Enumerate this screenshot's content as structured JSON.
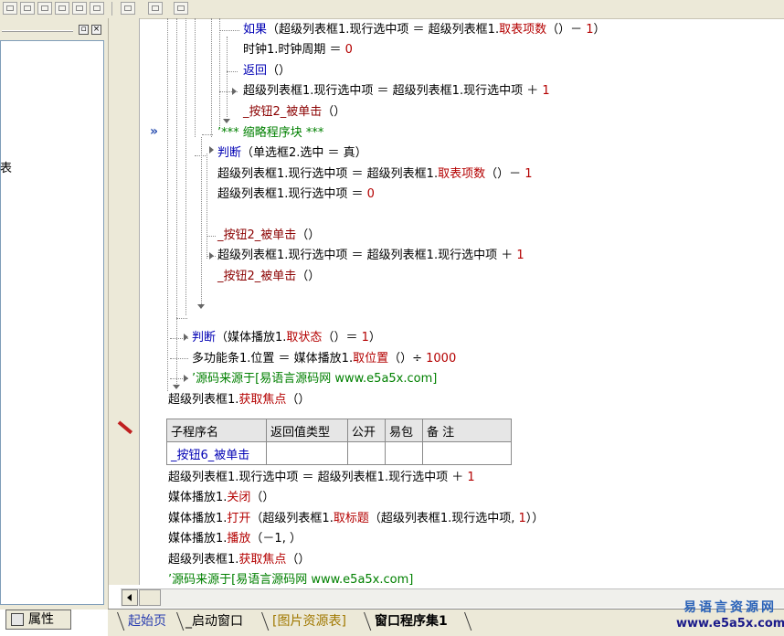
{
  "toolbar": {
    "icons": [
      "align-left-icon",
      "align-center-icon",
      "align-right-icon",
      "align-top-icon",
      "align-middle-icon",
      "align-bottom-icon",
      "same-width-icon",
      "same-height-icon",
      "same-size-icon"
    ]
  },
  "left_panel": {
    "fragment": "表",
    "properties_tab": "属性"
  },
  "code": {
    "line1": [
      "如果",
      "（超级列表框1.现行选中项 ＝ 超级列表框1.",
      "取表项数",
      "（）－ ",
      "1",
      "）"
    ],
    "line2": [
      "时钟1.时钟周期 ＝ ",
      "0"
    ],
    "line3": [
      "返回",
      "（）"
    ],
    "line4": [
      "超级列表框1.现行选中项 ＝ 超级列表框1.现行选中项 ＋ ",
      "1"
    ],
    "line5": [
      "_按钮2_被单击",
      "（）"
    ],
    "line6": "’*** 缩略程序块 ***",
    "line7": [
      "判断",
      "（单选框2.选中 ＝ 真）"
    ],
    "line8": [
      "超级列表框1.现行选中项 ＝ 超级列表框1.",
      "取表项数",
      "（）－ ",
      "1"
    ],
    "line9": [
      "超级列表框1.现行选中项 ＝ ",
      "0"
    ],
    "line10": [
      "_按钮2_被单击",
      "（）"
    ],
    "line11": [
      "超级列表框1.现行选中项 ＝ 超级列表框1.现行选中项 ＋ ",
      "1"
    ],
    "line12": [
      "_按钮2_被单击",
      "（）"
    ],
    "line13": [
      "判断",
      "（媒体播放1.",
      "取状态",
      "（）＝ ",
      "1",
      "）"
    ],
    "line14": [
      "多功能条1.位置 ＝ 媒体播放1.",
      "取位置",
      "（）÷ ",
      "1000"
    ],
    "line15": "’源码来源于[易语言源码网 www.e5a5x.com]",
    "line16": [
      "超级列表框1.",
      "获取焦点",
      "（）"
    ],
    "line17": [
      "超级列表框1.现行选中项 ＝ 超级列表框1.现行选中项 ＋ ",
      "1"
    ],
    "line18": [
      "媒体播放1.",
      "关闭",
      "（）"
    ],
    "line19": [
      "媒体播放1.",
      "打开",
      "（超级列表框1.",
      "取标题",
      "（超级列表框1.现行选中项, ",
      "1",
      "））"
    ],
    "line20": [
      "媒体播放1.",
      "播放",
      "（－1, ）"
    ],
    "line21": [
      "超级列表框1.",
      "获取焦点",
      "（）"
    ],
    "line22": "’源码来源于[易语言源码网 www.e5a5x.com]"
  },
  "subtable": {
    "headers": [
      "子程序名",
      "返回值类型",
      "公开",
      "易包",
      "备 注"
    ],
    "row": [
      "_按钮6_被单击",
      "",
      "",
      "",
      ""
    ]
  },
  "tabs": [
    "起始页",
    "_启动窗口",
    "[图片资源表]",
    "窗口程序集1"
  ],
  "watermark": {
    "line1": "易语言资源网",
    "line2": "www.e5a5x.com"
  },
  "colors": {
    "keyword": "#0000b4",
    "method": "#b40000",
    "call": "#8b0000",
    "comment": "#008000",
    "panel": "#ece9d8"
  }
}
